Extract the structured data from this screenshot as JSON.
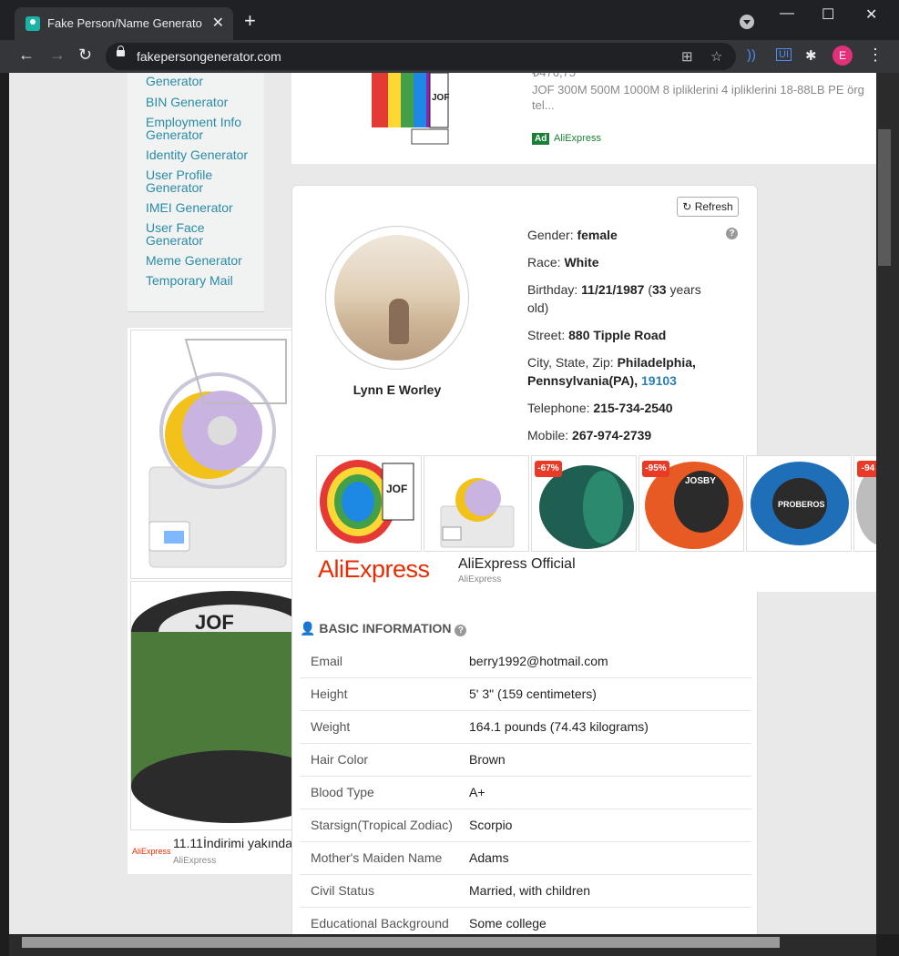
{
  "browser": {
    "tab_title": "Fake Person/Name Generator | U",
    "tab_close": "✕",
    "new_tab": "+",
    "url": "fakepersongenerator.com",
    "profile_initial": "E",
    "icons": [
      "back-icon",
      "forward-icon",
      "reload-icon",
      "lock-icon",
      "translate-icon",
      "star-icon",
      "extension-icon",
      "puzzle-icon",
      "menu-icon"
    ]
  },
  "sidebar": {
    "items": [
      {
        "label": "Generator"
      },
      {
        "label": "BIN Generator"
      },
      {
        "label": "Employment Info Generator"
      },
      {
        "label": "Identity Generator"
      },
      {
        "label": "User Profile Generator"
      },
      {
        "label": "IMEI Generator"
      },
      {
        "label": "User Face Generator"
      },
      {
        "label": "Meme Generator"
      },
      {
        "label": "Temporary Mail"
      }
    ]
  },
  "top_ad": {
    "price": "₺476,75",
    "text": "JOF 300M 500M 1000M 8 ipliklerini 4 ipliklerini 18-88LB PE örg tel...",
    "badge": "Ad",
    "source": "AliExpress"
  },
  "left_ad": {
    "title": "11.11İndirimi yakında",
    "source": "AliExpress",
    "logo": "AliExpress"
  },
  "profile": {
    "refresh_label": "Refresh",
    "help": "?",
    "name": "Lynn E Worley",
    "gender_label": "Gender:",
    "gender": "female",
    "race_label": "Race:",
    "race": "White",
    "birthday_label": "Birthday:",
    "birthday": "11/21/1987",
    "age_open": "(",
    "age": "33",
    "age_suffix": "years old)",
    "street_label": "Street:",
    "street": "880 Tipple Road",
    "city_label": "City, State, Zip:",
    "city": "Philadelphia, Pennsylvania(PA),",
    "zip": "19103",
    "telephone_label": "Telephone:",
    "telephone": "215-734-2540",
    "mobile_label": "Mobile:",
    "mobile": "267-974-2739"
  },
  "carousel": {
    "discounts": [
      "-67%",
      "-95%",
      "-94"
    ],
    "logo_main": "AliExpress",
    "name": "AliExpress Official",
    "sub": "AliExpress"
  },
  "basic_info": {
    "title": "BASIC INFORMATION",
    "rows": [
      {
        "label": "Email",
        "value": "berry1992@hotmail.com"
      },
      {
        "label": "Height",
        "value": "5' 3\" (159 centimeters)"
      },
      {
        "label": "Weight",
        "value": "164.1 pounds (74.43 kilograms)"
      },
      {
        "label": "Hair Color",
        "value": "Brown"
      },
      {
        "label": "Blood Type",
        "value": "A+"
      },
      {
        "label": "Starsign(Tropical Zodiac)",
        "value": "Scorpio"
      },
      {
        "label": "Mother's Maiden Name",
        "value": "Adams"
      },
      {
        "label": "Civil Status",
        "value": "Married, with children"
      },
      {
        "label": "Educational Background",
        "value": "Some college"
      }
    ]
  }
}
